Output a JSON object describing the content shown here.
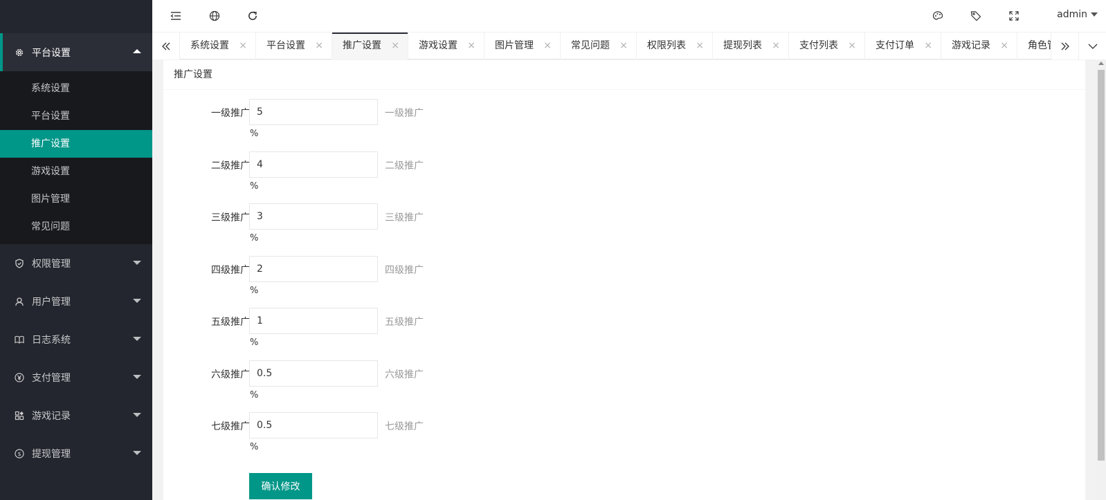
{
  "sidebar": {
    "groups": [
      {
        "label": "平台设置",
        "icon": "gear-icon",
        "open": true,
        "items": [
          "系统设置",
          "平台设置",
          "推广设置",
          "游戏设置",
          "图片管理",
          "常见问题"
        ]
      },
      {
        "label": "权限管理",
        "icon": "shield-icon"
      },
      {
        "label": "用户管理",
        "icon": "user-icon"
      },
      {
        "label": "日志系统",
        "icon": "book-icon"
      },
      {
        "label": "支付管理",
        "icon": "yen-icon"
      },
      {
        "label": "游戏记录",
        "icon": "apps-icon"
      },
      {
        "label": "提现管理",
        "icon": "dollar-icon"
      }
    ],
    "active_item": "推广设置"
  },
  "header": {
    "icons": [
      "menu-shrink-icon",
      "globe-icon",
      "refresh-icon",
      "palette-icon",
      "tag-icon",
      "fullscreen-icon"
    ],
    "user": "admin"
  },
  "tabs": {
    "items": [
      "系统设置",
      "平台设置",
      "推广设置",
      "游戏设置",
      "图片管理",
      "常见问题",
      "权限列表",
      "提现列表",
      "支付列表",
      "支付订单",
      "游戏记录",
      "角色管理"
    ],
    "active": "推广设置",
    "close_glyph": "×"
  },
  "page": {
    "title": "推广设置",
    "rows": [
      {
        "label": "一级推广",
        "value": "5",
        "aux": "一级推广",
        "unit": "%"
      },
      {
        "label": "二级推广",
        "value": "4",
        "aux": "二级推广",
        "unit": "%"
      },
      {
        "label": "三级推广",
        "value": "3",
        "aux": "三级推广",
        "unit": "%"
      },
      {
        "label": "四级推广",
        "value": "2",
        "aux": "四级推广",
        "unit": "%"
      },
      {
        "label": "五级推广",
        "value": "1",
        "aux": "五级推广",
        "unit": "%"
      },
      {
        "label": "六级推广",
        "value": "0.5",
        "aux": "六级推广",
        "unit": "%"
      },
      {
        "label": "七级推广",
        "value": "0.5",
        "aux": "七级推广",
        "unit": "%"
      }
    ],
    "submit_label": "确认修改"
  },
  "colors": {
    "accent": "#009688",
    "sidebar_bg": "#23262e",
    "submenu_bg": "#18191d"
  }
}
